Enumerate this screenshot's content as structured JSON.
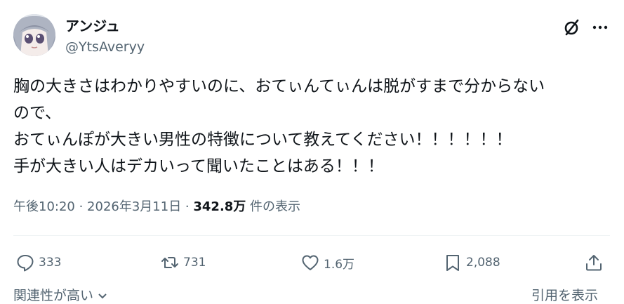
{
  "author": {
    "display_name": "アンジュ",
    "handle": "@YtsAveryy"
  },
  "header_icons": [
    "grok-icon",
    "more-icon"
  ],
  "tweet": {
    "lines": [
      "胸の大きさはわかりやすいのに、おてぃんてぃんは脱がすまで分からない",
      "ので、",
      "おてぃんぽが大きい男性の特徴について教えてください！！！！！！",
      "手が大きい人はデカいって聞いたことはある！！！"
    ]
  },
  "meta": {
    "timestamp": "午後10:20 · 2026年3月11日 · ",
    "views": "342.8万",
    "views_suffix": " 件の表示"
  },
  "actions": {
    "replies": "333",
    "reposts": "731",
    "likes": "1.6万",
    "bookmarks": "2,088"
  },
  "footer": {
    "related_label": "関連性が高い",
    "quote_label": "引用を表示"
  },
  "colors": {
    "text": "#0f1419",
    "muted": "#536471",
    "divider": "#eff3f4"
  }
}
